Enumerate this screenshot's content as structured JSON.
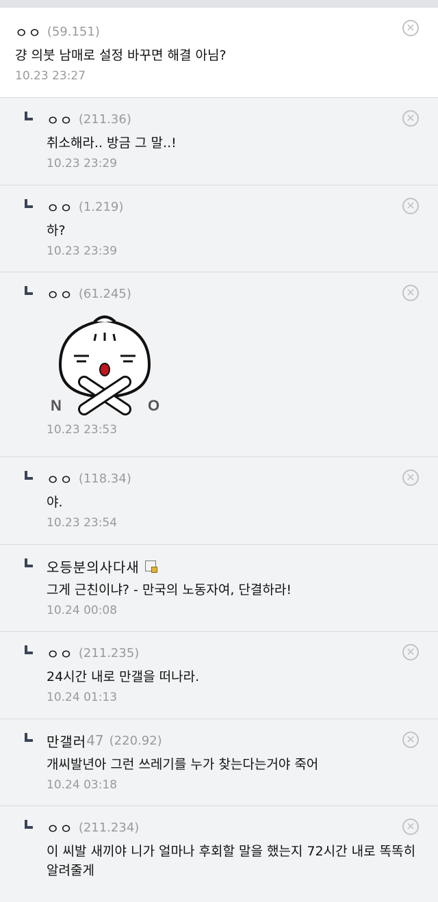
{
  "comments": [
    {
      "nick": "ㅇㅇ",
      "ip": "(59.151)",
      "text": "걍 의붓 남매로 설정 바꾸면 해결 아님?",
      "date": "10.23 23:27"
    },
    {
      "nick": "ㅇㅇ",
      "ip": "(211.36)",
      "text": "취소해라.. 방금 그 말..!",
      "date": "10.23 23:29"
    },
    {
      "nick": "ㅇㅇ",
      "ip": "(1.219)",
      "text": "하?",
      "date": "10.23 23:39"
    },
    {
      "nick": "ㅇㅇ",
      "ip": "(61.245)",
      "sticker_left": "N",
      "sticker_right": "O",
      "date": "10.23 23:53"
    },
    {
      "nick": "ㅇㅇ",
      "ip": "(118.34)",
      "text": "야.",
      "date": "10.23 23:54"
    },
    {
      "nick": "오등분의사다새",
      "text": "그게 근친이냐? - 만국의 노동자여, 단결하라!",
      "date": "10.24 00:08"
    },
    {
      "nick": "ㅇㅇ",
      "ip": "(211.235)",
      "text": "24시간 내로 만갤을 떠나라.",
      "date": "10.24 01:13"
    },
    {
      "nick": "만갤러",
      "nick_suffix": "47",
      "ip": "(220.92)",
      "text": "개씨발년아 그런 쓰레기를 누가 찾는다는거야 죽어",
      "date": "10.24 03:18"
    },
    {
      "nick": "ㅇㅇ",
      "ip": "(211.234)",
      "text": "이 씨발 새끼야 니가 얼마나 후회할 말을 했는지 72시간 내로 똑똑히 알려줄게"
    }
  ],
  "icons": {
    "delete": "close-circle-icon",
    "reply": "reply-arrow-icon",
    "gallog": "gallog-icon"
  }
}
